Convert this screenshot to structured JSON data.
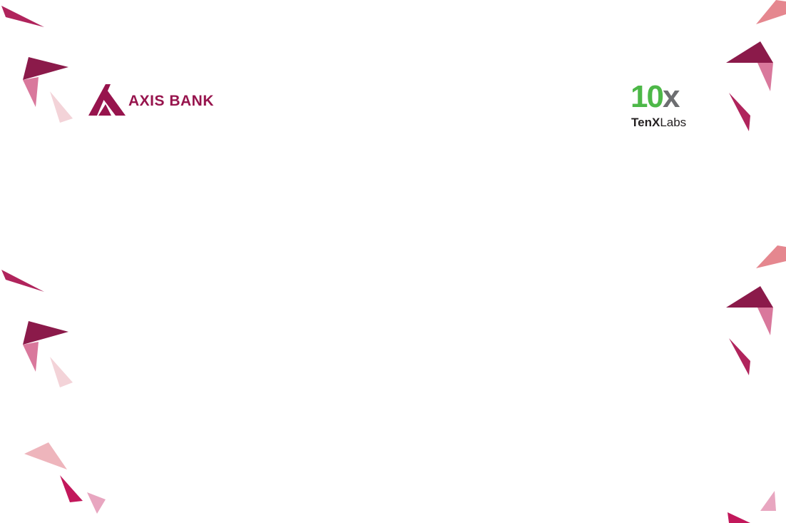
{
  "slide": {
    "background": "#ffffff"
  },
  "logos": {
    "axis_bank": {
      "text": "AXIS BANK",
      "color": "#97144d",
      "icon": "axis-bank-a-mark"
    },
    "tenx_labs": {
      "mark_digits": "10",
      "mark_letter": "x",
      "word_ten": "Ten",
      "word_x": "X",
      "word_labs": "Labs",
      "mark_green": "#4db848",
      "mark_grey": "#6d6e71"
    }
  },
  "decoration": {
    "shape": "triangle-shards",
    "colors": {
      "deep": "#8b1a4a",
      "magenta": "#b0245c",
      "rose": "#d9789c",
      "coral": "#e5878f",
      "pale": "#f3d3d8",
      "light_rose": "#e8a6c0"
    }
  }
}
